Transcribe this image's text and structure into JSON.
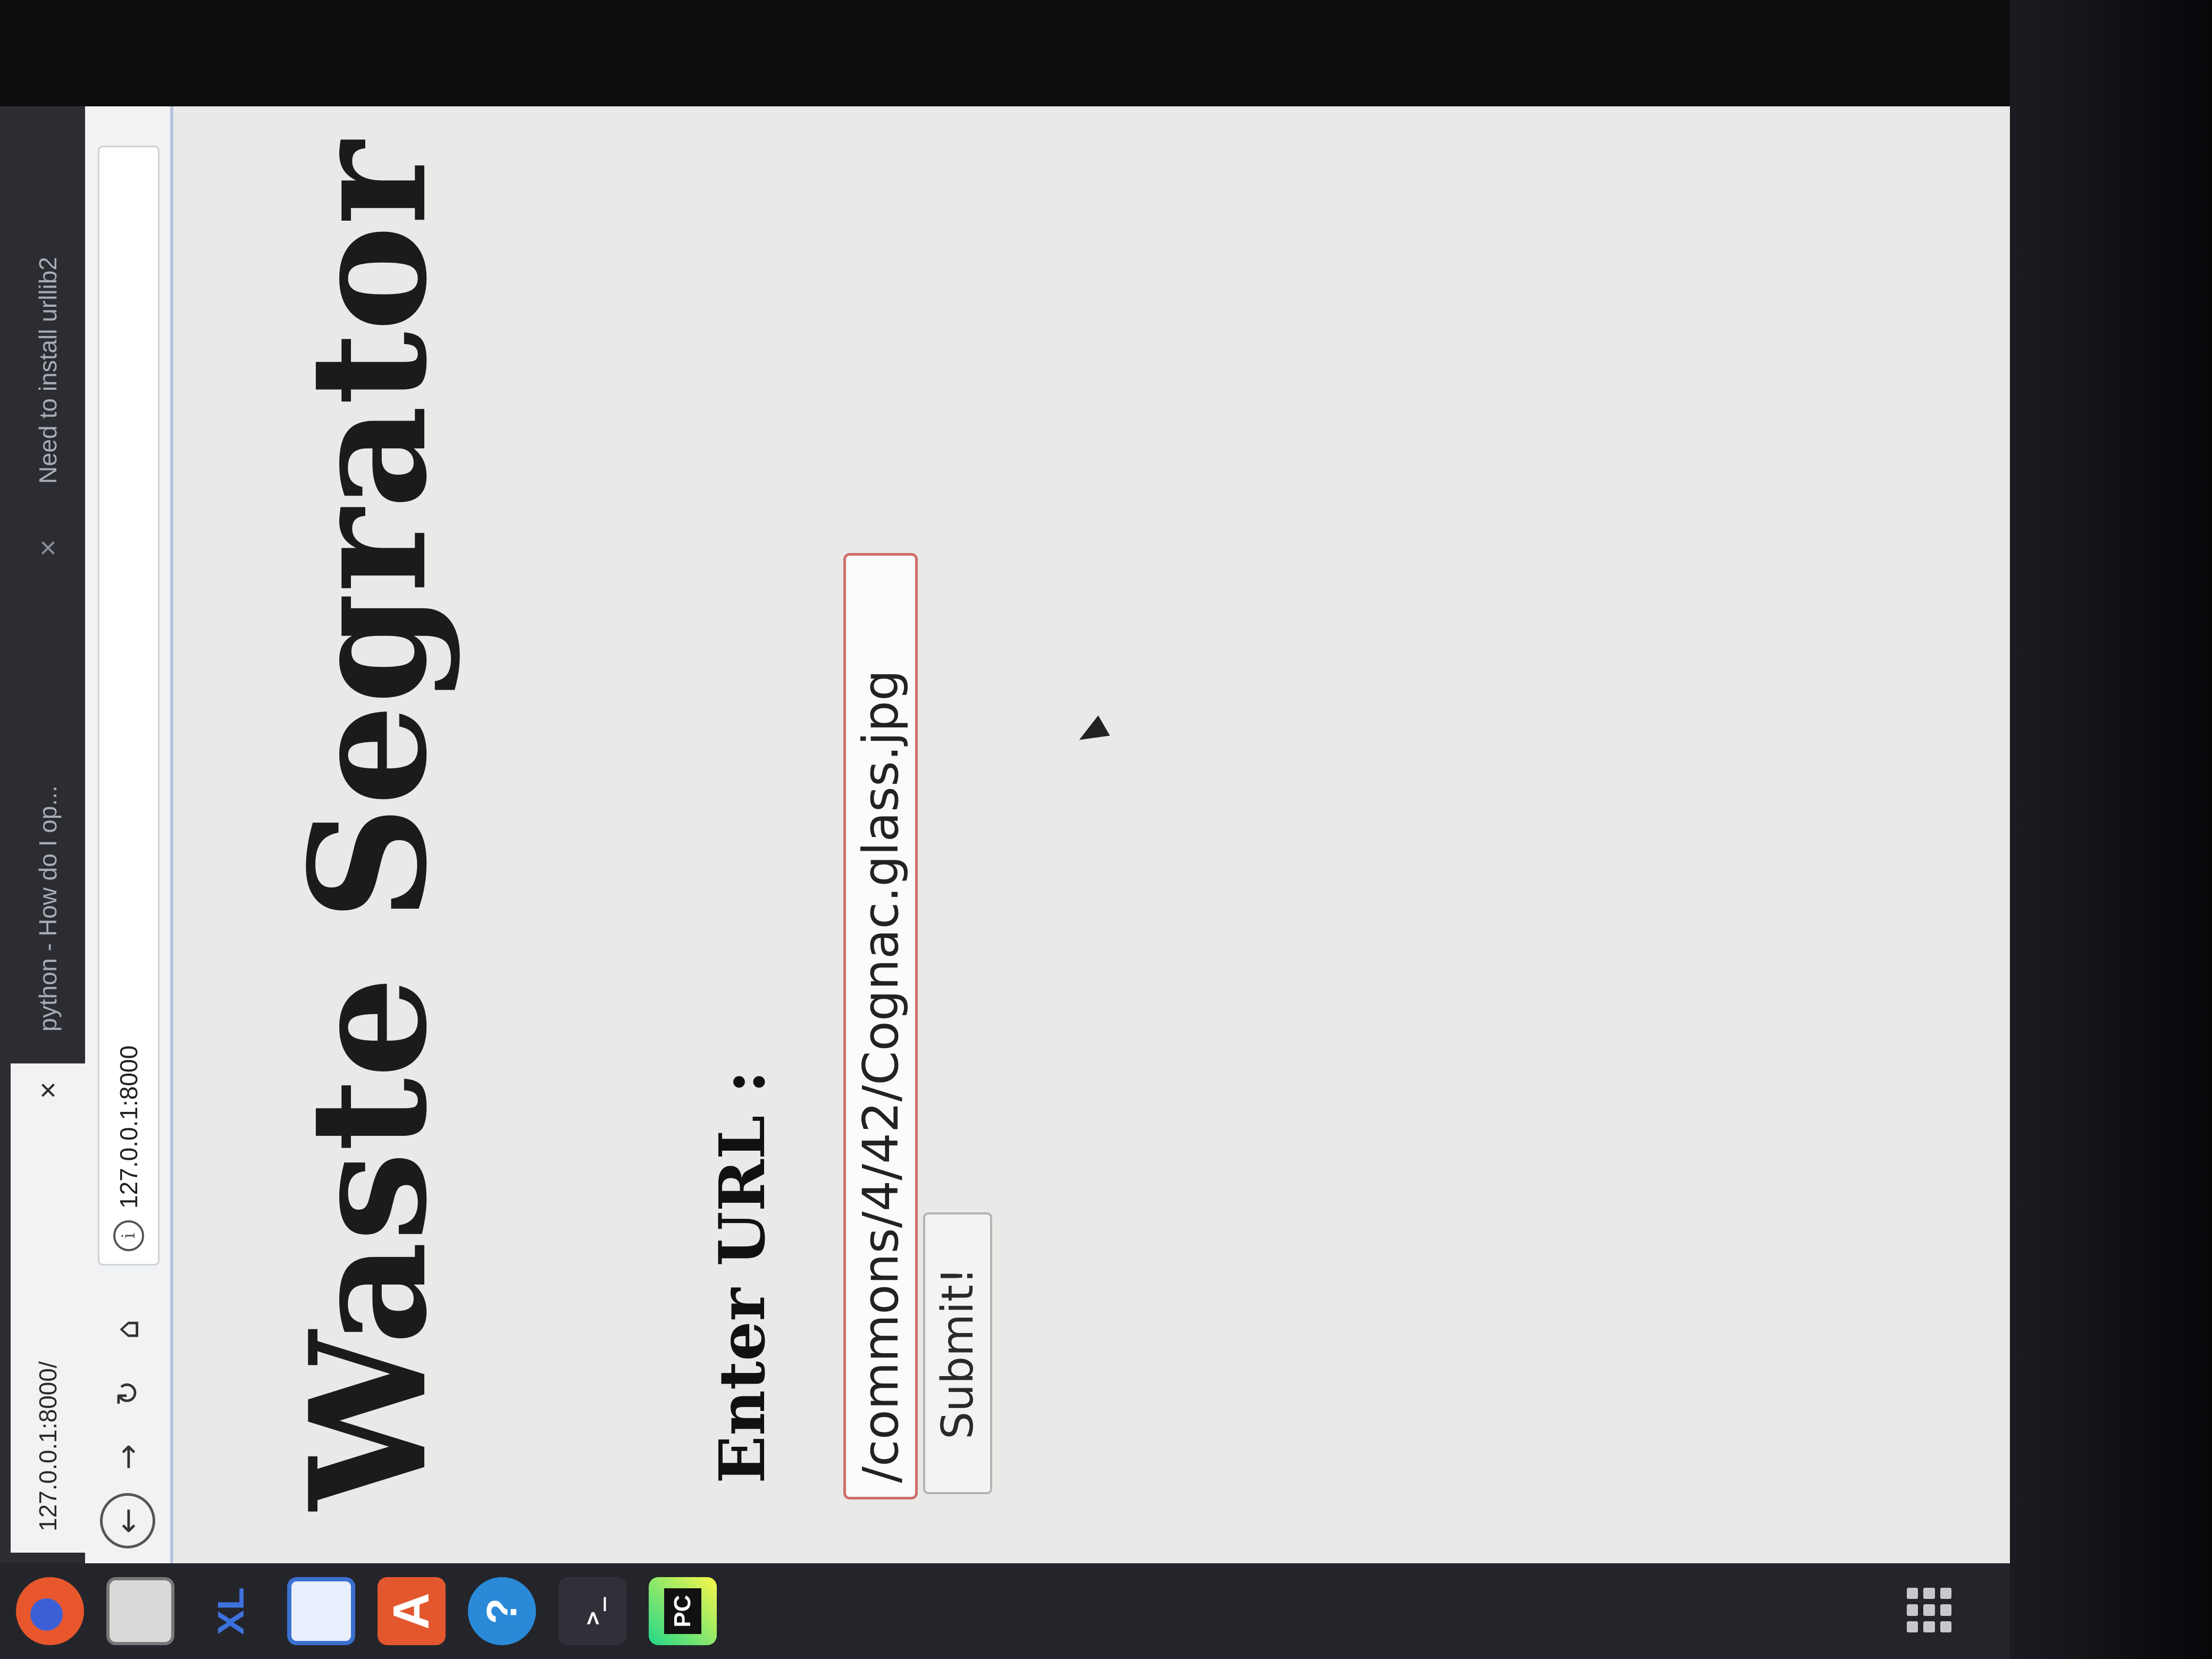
{
  "browser": {
    "active_tab_title": "127.0.0.1:8000/",
    "inactive_tab_title": "python - How do I op...",
    "second_tab_fragment": "Need to install urllib2",
    "bookmark_fragment": "urlli",
    "close_glyph": "×",
    "url": "127.0.0.1:8000"
  },
  "page": {
    "title": "Waste Segrator",
    "url_label": "Enter URL :",
    "url_input_value": "/commons/4/42/Cognac.glass.jpg",
    "submit_label": "Submit!"
  },
  "dock": {
    "items": [
      {
        "name": "firefox-icon",
        "color": "#e8572c"
      },
      {
        "name": "files-icon",
        "color": "#d9d9d9"
      },
      {
        "name": "xl-icon",
        "label": "XL",
        "color": "#2a64c8"
      },
      {
        "name": "document-viewer-icon",
        "color": "#3b6fd0"
      },
      {
        "name": "software-center-icon",
        "label": "A",
        "color": "#e2572e"
      },
      {
        "name": "help-icon",
        "label": "?",
        "color": "#2a8ad8"
      },
      {
        "name": "terminal-icon",
        "label": ">_",
        "color": "#2f3038"
      },
      {
        "name": "pycharm-icon",
        "label": "PC",
        "color": "#1b1b1b"
      }
    ]
  },
  "icons": {
    "back": "←",
    "forward": "→",
    "reload": "↻",
    "home": "⌂",
    "info": "i"
  }
}
